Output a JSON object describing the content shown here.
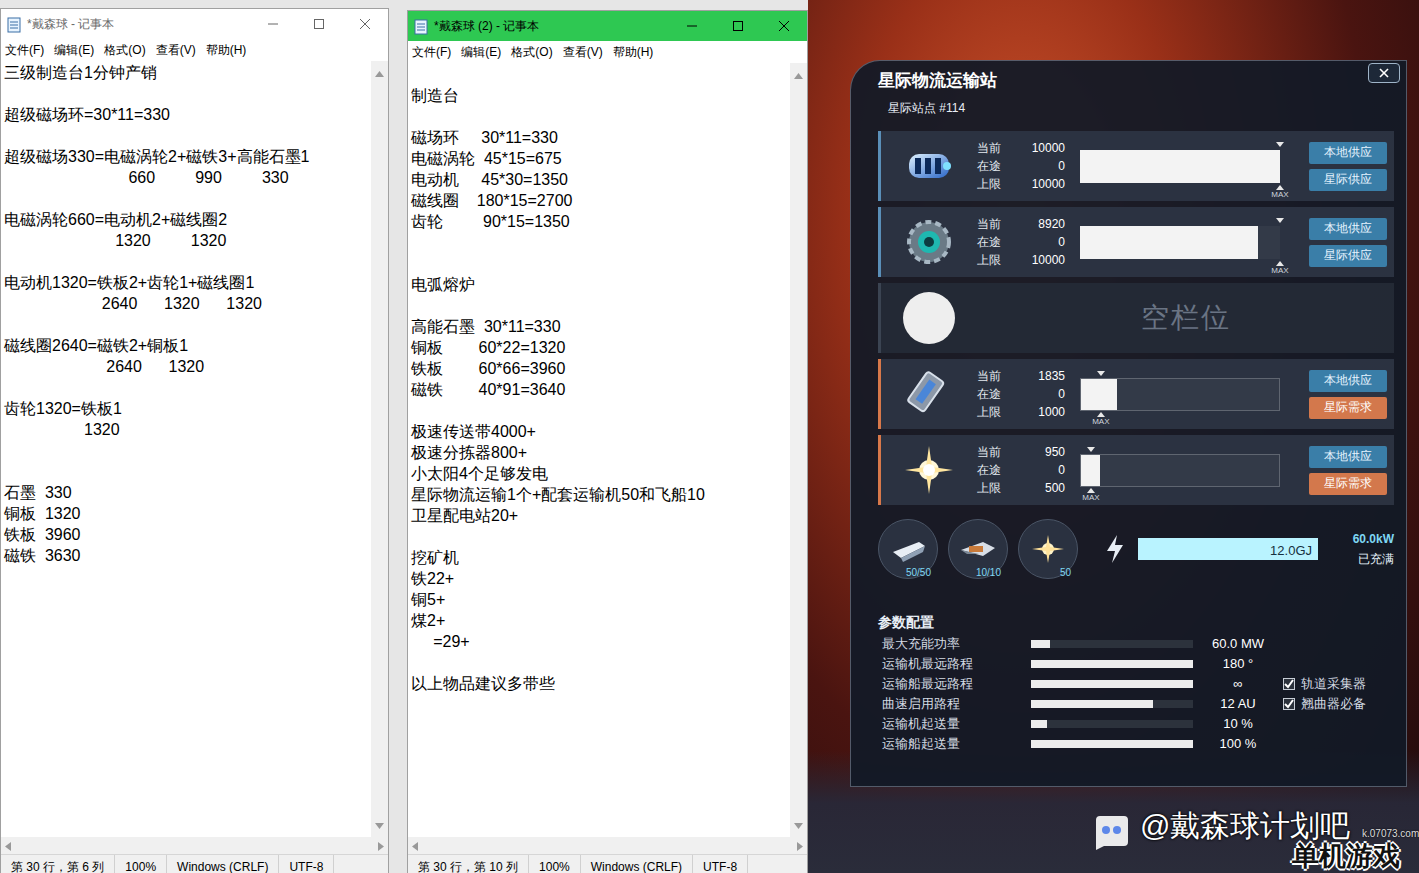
{
  "notepads": [
    {
      "title": "*戴森球 - 记事本",
      "focused": false,
      "menu": [
        "文件(F)",
        "编辑(E)",
        "格式(O)",
        "查看(V)",
        "帮助(H)"
      ],
      "lines": [
        "三级制造台1分钟产销",
        "",
        "超级磁场环=30*11=330",
        "",
        "超级磁场330=电磁涡轮2+磁铁3+高能石墨1",
        "                            660         990         330",
        "",
        "电磁涡轮660=电动机2+磁线圈2",
        "                         1320         1320",
        "",
        "电动机1320=铁板2+齿轮1+磁线圈1",
        "                      2640      1320      1320",
        "",
        "磁线圈2640=磁铁2+铜板1",
        "                       2640      1320",
        "",
        "齿轮1320=铁板1",
        "                  1320",
        "",
        "",
        "石墨  330",
        "铜板  1320",
        "铁板  3960",
        "磁铁  3630"
      ],
      "status": [
        "第 30 行，第 6 列",
        "100%",
        "Windows (CRLF)",
        "UTF-8"
      ]
    },
    {
      "title": "*戴森球 (2) - 记事本",
      "focused": true,
      "menu": [
        "文件(F)",
        "编辑(E)",
        "格式(O)",
        "查看(V)",
        "帮助(H)"
      ],
      "lines": [
        "",
        "制造台",
        "",
        "磁场环     30*11=330",
        "电磁涡轮  45*15=675",
        "电动机     45*30=1350",
        "磁线圈    180*15=2700",
        "齿轮         90*15=1350",
        "",
        "",
        "电弧熔炉",
        "",
        "高能石墨  30*11=330",
        "铜板        60*22=1320",
        "铁板        60*66=3960",
        "磁铁        40*91=3640",
        "",
        "极速传送带4000+",
        "极速分拣器800+",
        "小太阳4个足够发电",
        "星际物流运输1个+配套运输机50和飞船10",
        "卫星配电站20+",
        "",
        "挖矿机",
        "铁22+",
        "铜5+",
        "煤2+",
        "     =29+",
        "",
        "以上物品建议多带些"
      ],
      "status": [
        "第 30 行，第 10 列",
        "100%",
        "Windows (CRLF)",
        "UTF-8"
      ]
    }
  ],
  "station": {
    "title": "星际物流运输站",
    "subtitle": "星际站点 #114",
    "slots": [
      {
        "kind": "supply",
        "fields": [
          {
            "label": "当前",
            "value": "10000"
          },
          {
            "label": "在途",
            "value": "0"
          },
          {
            "label": "上限",
            "value": "10000"
          }
        ],
        "level": 1.0,
        "max_level": 1.0,
        "max_label": "MAX",
        "buttons": [
          {
            "label": "本地供应",
            "kind": "blue"
          },
          {
            "label": "星际供应",
            "kind": "blue"
          }
        ]
      },
      {
        "kind": "supply",
        "fields": [
          {
            "label": "当前",
            "value": "8920"
          },
          {
            "label": "在途",
            "value": "0"
          },
          {
            "label": "上限",
            "value": "10000"
          }
        ],
        "level": 0.892,
        "max_level": 1.0,
        "max_label": "MAX",
        "buttons": [
          {
            "label": "本地供应",
            "kind": "blue"
          },
          {
            "label": "星际供应",
            "kind": "blue"
          }
        ]
      },
      {
        "kind": "empty",
        "label": "空栏位"
      },
      {
        "kind": "demand",
        "fields": [
          {
            "label": "当前",
            "value": "1835"
          },
          {
            "label": "在途",
            "value": "0"
          },
          {
            "label": "上限",
            "value": "1000"
          }
        ],
        "level": 0.1835,
        "max_level": 0.1,
        "max_label": "MAX",
        "buttons": [
          {
            "label": "本地供应",
            "kind": "blue"
          },
          {
            "label": "星际需求",
            "kind": "orange"
          }
        ]
      },
      {
        "kind": "demand",
        "fields": [
          {
            "label": "当前",
            "value": "950"
          },
          {
            "label": "在途",
            "value": "0"
          },
          {
            "label": "上限",
            "value": "500"
          }
        ],
        "level": 0.095,
        "max_level": 0.05,
        "max_label": "MAX",
        "buttons": [
          {
            "label": "本地供应",
            "kind": "blue"
          },
          {
            "label": "星际需求",
            "kind": "orange"
          }
        ]
      }
    ],
    "vessels": [
      {
        "count": "50/50"
      },
      {
        "count": "10/10"
      },
      {
        "count": "50"
      }
    ],
    "energy": {
      "reading": "12.0GJ",
      "level": 1.0,
      "power": "60.0kW",
      "state": "已充满"
    },
    "params": {
      "title": "参数配置",
      "rows": [
        {
          "label": "最大充能功率",
          "level": 0.12,
          "reading": "60.0 MW"
        },
        {
          "label": "运输机最远路程",
          "level": 1.0,
          "reading": "180 °"
        },
        {
          "label": "运输船最远路程",
          "level": 1.0,
          "reading": "∞"
        },
        {
          "label": "曲速启用路程",
          "level": 0.75,
          "reading": "12 AU"
        },
        {
          "label": "运输机起送量",
          "level": 0.1,
          "reading": "10 %"
        },
        {
          "label": "运输船起送量",
          "level": 1.0,
          "reading": "100 %"
        }
      ],
      "checks": [
        {
          "label": "轨道采集器",
          "checked": true
        },
        {
          "label": "翘曲器必备",
          "checked": true
        }
      ]
    }
  },
  "watermark": {
    "handle": "@戴森球计划吧",
    "site": "k.07073.com",
    "logo": "单机游戏"
  }
}
